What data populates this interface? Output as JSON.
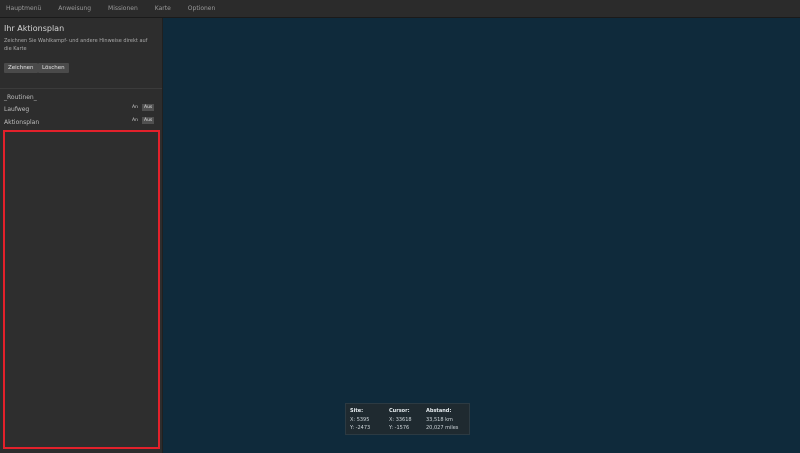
{
  "nav": {
    "items": [
      "Hauptmenü",
      "Anweisung",
      "Missionen",
      "Karte",
      "Optionen"
    ]
  },
  "sidebar": {
    "title": "Ihr Aktionsplan",
    "description": "Zeichnen Sie Wahlkampf- und andere Hinweise direkt auf die Karte",
    "draw_button": "Zeichnen",
    "delete_button": "Löschen",
    "section_header": "_Routinen_",
    "layers": [
      {
        "label": "Laufweg",
        "on_label": "An",
        "off_label": "Aus"
      },
      {
        "label": "Aktionsplan",
        "on_label": "An",
        "off_label": "Aus"
      }
    ]
  },
  "coords": {
    "site_label": "Site:",
    "site_x": "X: 5395",
    "site_y": "Y: -2473",
    "cursor_label": "Cursor:",
    "cursor_x": "X: 33618",
    "cursor_y": "Y: -1576",
    "distance_label": "Abstand:",
    "distance_km": "33,518 km",
    "distance_miles": "20,027 miles"
  },
  "colors": {
    "map_background": "#0f2a3b",
    "sidebar_background": "#2d2d2d",
    "highlight_border": "#e3212b"
  }
}
